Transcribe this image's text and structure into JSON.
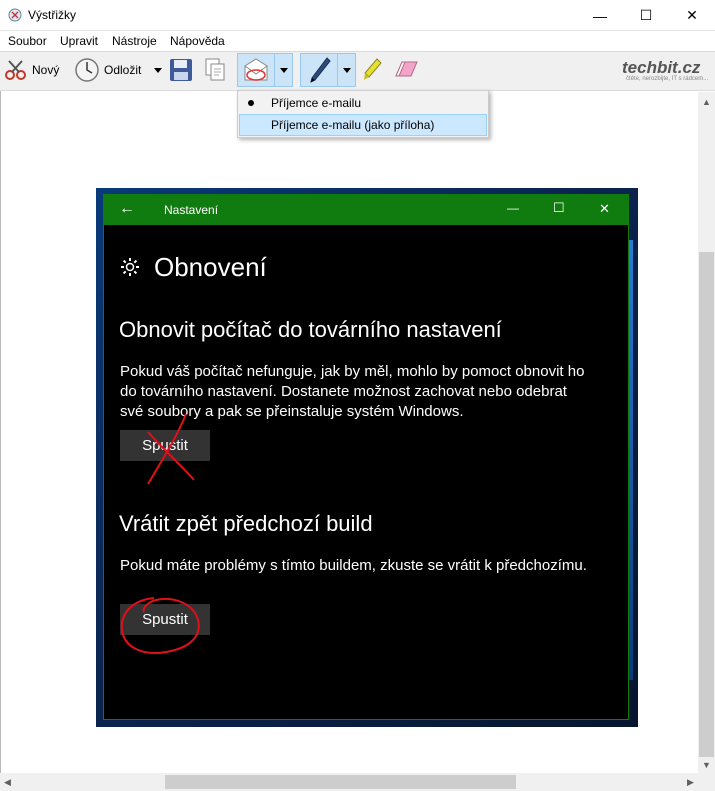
{
  "window": {
    "title": "Výstřižky",
    "icon": "scissors-app-icon",
    "controls": {
      "minimize": "—",
      "maximize": "☐",
      "close": "✕"
    }
  },
  "menu": [
    "Soubor",
    "Upravit",
    "Nástroje",
    "Nápověda"
  ],
  "toolbar": {
    "new_label": "Nový",
    "delay_label": "Odložit",
    "brand": "techbit.cz",
    "brand_sub": "čtěte, nerozbijte, IT s rádcem..."
  },
  "dropdown": {
    "items": [
      "Příjemce e-mailu",
      "Příjemce e-mailu (jako příloha)"
    ],
    "highlighted_index": 1,
    "checked_index": 0
  },
  "screenshot": {
    "window_title": "Nastavení",
    "back_glyph": "←",
    "controls": {
      "minimize": "—",
      "maximize": "☐",
      "close": "✕"
    },
    "page_heading": "Obnovení",
    "sections": [
      {
        "title": "Obnovit počítač do továrního nastavení",
        "body": "Pokud váš počítač nefunguje, jak by měl, mohlo by pomoct obnovit ho do továrního nastavení. Dostanete možnost zachovat nebo odebrat své soubory a pak se přeinstaluje systém Windows.",
        "button": "Spustit"
      },
      {
        "title": "Vrátit zpět předchozí build",
        "body": "Pokud máte problémy s tímto buildem, zkuste se vrátit k předchozímu.",
        "button": "Spustit"
      }
    ],
    "annotations": {
      "cross_color": "#e0101a",
      "circle_color": "#e0101a"
    }
  },
  "colors": {
    "settings_accent": "#107c10",
    "toolbar_selected": "#cce4f7",
    "dropdown_highlight": "#cce8ff"
  }
}
